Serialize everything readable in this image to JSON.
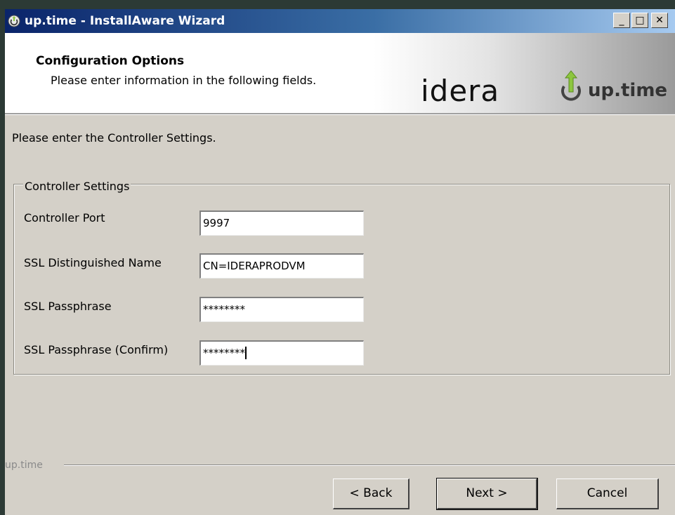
{
  "window": {
    "title": "up.time - InstallAware Wizard",
    "controls": {
      "minimize": "_",
      "maximize": "□",
      "close": "✕"
    }
  },
  "header": {
    "title": "Configuration Options",
    "subtitle": "Please enter information in the following fields.",
    "logo": {
      "brand": "idera",
      "product": "up.time"
    }
  },
  "instruction": "Please enter the Controller Settings.",
  "group": {
    "title": "Controller Settings",
    "fields": [
      {
        "label": "Controller Port",
        "value": "9997"
      },
      {
        "label": "SSL Distinguished Name",
        "value": "CN=IDERAPRODVM"
      },
      {
        "label": "SSL Passphrase",
        "value": "********"
      },
      {
        "label": "SSL Passphrase (Confirm)",
        "value": "********"
      }
    ]
  },
  "footer": {
    "brand": "up.time",
    "buttons": {
      "back": "< Back",
      "next": "Next >",
      "cancel": "Cancel"
    }
  },
  "colors": {
    "title_bar": "#0a246a",
    "dialog_face": "#d4d0c8",
    "logo_green": "#8dc63f"
  },
  "icons": [
    "uptime-power-icon",
    "minimize-icon",
    "maximize-icon",
    "close-icon"
  ]
}
